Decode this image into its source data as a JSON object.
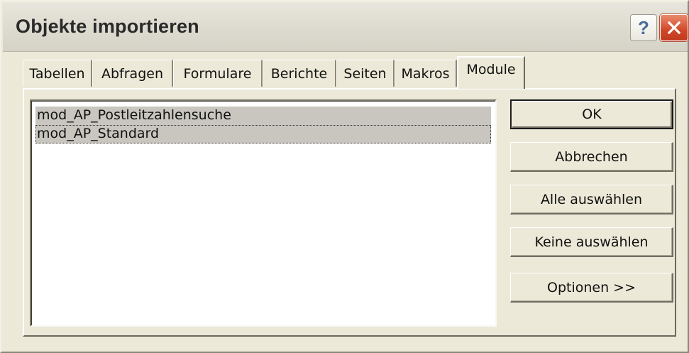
{
  "window": {
    "title": "Objekte importieren",
    "help_glyph": "?",
    "controls": [
      "help-icon",
      "close-icon"
    ],
    "accent_close_color": "#d2472a"
  },
  "tabs": [
    {
      "label": "Tabellen",
      "active": false
    },
    {
      "label": "Abfragen",
      "active": false
    },
    {
      "label": "Formulare",
      "active": false
    },
    {
      "label": "Berichte",
      "active": false
    },
    {
      "label": "Seiten",
      "active": false
    },
    {
      "label": "Makros",
      "active": false
    },
    {
      "label": "Module",
      "active": true
    }
  ],
  "object_list": {
    "items": [
      {
        "label": "mod_AP_Postleitzahlensuche",
        "selected": true
      },
      {
        "label": "mod_AP_Standard",
        "selected": true
      }
    ]
  },
  "buttons": {
    "ok": "OK",
    "cancel": "Abbrechen",
    "select_all": "Alle auswählen",
    "select_none": "Keine auswählen",
    "options": "Optionen >>"
  }
}
